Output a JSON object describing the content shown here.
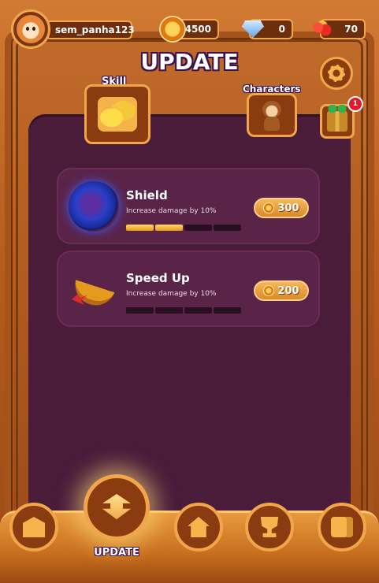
{
  "header": {
    "username": "sem_panha123",
    "coins": "4500",
    "gems": "0",
    "fruits": "70"
  },
  "page": {
    "title": "UPDATE",
    "tabs": {
      "skill_label": "Skill",
      "characters_label": "Characters"
    },
    "gift_badge_count": "1"
  },
  "skills": [
    {
      "name": "Shield",
      "description": "Increase damage by 10%",
      "cost": "300",
      "level": 2,
      "max_level": 4
    },
    {
      "name": "Speed Up",
      "description": "Increase damage by 10%",
      "cost": "200",
      "level": 0,
      "max_level": 4
    }
  ],
  "bottom_nav": {
    "active_label": "UPDATE"
  },
  "colors": {
    "panel": "#4a1c3a",
    "card": "#5a2448",
    "accent": "#f2a64a",
    "wood": "#8a3c10"
  },
  "icons": {
    "shop": "shop-icon",
    "update": "upgrade-arrows-icon",
    "home": "home-icon",
    "trophy": "trophy-icon",
    "wallet": "wallet-icon"
  }
}
